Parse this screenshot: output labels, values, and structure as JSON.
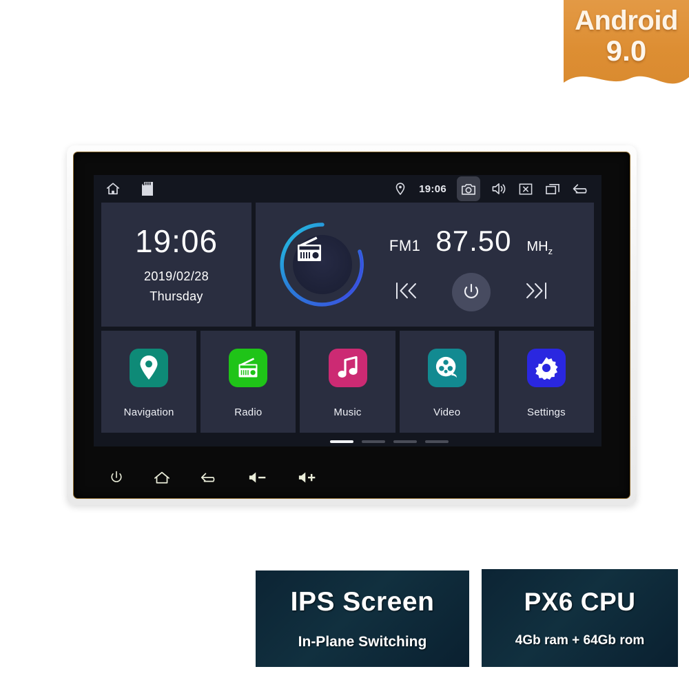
{
  "badge": {
    "os_name": "Android",
    "os_version": "9.0",
    "color": "#dd8e33"
  },
  "statusbar": {
    "left_icons": [
      {
        "name": "home-icon",
        "label": "Home"
      },
      {
        "name": "sd-card-icon",
        "label": "SD Card"
      }
    ],
    "location_icon": "location-pin-icon",
    "time": "19:06",
    "right_icons": [
      {
        "name": "camera-icon",
        "label": "Camera",
        "highlighted": true
      },
      {
        "name": "volume-icon",
        "label": "Volume"
      },
      {
        "name": "close-box-icon",
        "label": "Close"
      },
      {
        "name": "recents-icon",
        "label": "Recent Apps"
      },
      {
        "name": "back-icon",
        "label": "Back"
      }
    ]
  },
  "clock_widget": {
    "time": "19:06",
    "date": "2019/02/28",
    "weekday": "Thursday"
  },
  "radio_widget": {
    "icon": "radio-icon",
    "band": "FM1",
    "frequency": "87.50",
    "unit": "MH",
    "unit_sub": "z",
    "prev_label": "|«",
    "next_label": "»|",
    "power_label": "Power",
    "ring_color_start": "#22c4e0",
    "ring_color_end": "#3b4fe0"
  },
  "apps": [
    {
      "label": "Navigation",
      "icon": "location-pin-icon",
      "color": "#0e8a77"
    },
    {
      "label": "Radio",
      "icon": "radio-icon",
      "color": "#1fc418"
    },
    {
      "label": "Music",
      "icon": "music-note-icon",
      "color": "#cc2a73"
    },
    {
      "label": "Video",
      "icon": "film-reel-icon",
      "color": "#128a91"
    },
    {
      "label": "Settings",
      "icon": "gear-icon",
      "color": "#2a27e0"
    }
  ],
  "page_indicator": {
    "total": 4,
    "active": 1
  },
  "hardware_buttons": [
    {
      "name": "power-button",
      "label": "Power"
    },
    {
      "name": "home-button",
      "label": "Home"
    },
    {
      "name": "back-button",
      "label": "Back"
    },
    {
      "name": "volume-down-button",
      "label": "Volume Down"
    },
    {
      "name": "volume-up-button",
      "label": "Volume Up"
    }
  ],
  "banners": {
    "ips": {
      "title": "IPS Screen",
      "subtitle": "In-Plane Switching"
    },
    "cpu": {
      "title": "PX6 CPU",
      "subtitle": "4Gb ram + 64Gb rom"
    }
  }
}
